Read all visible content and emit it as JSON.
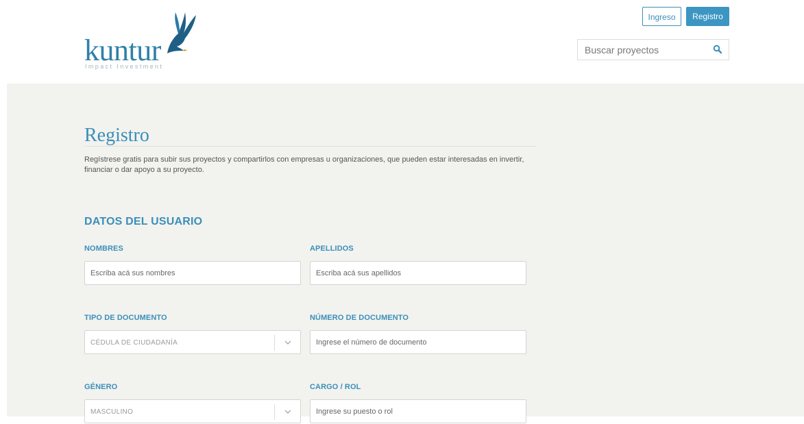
{
  "brand": {
    "name": "kuntur",
    "tagline": "Impact Investment",
    "accent": "#3b8fb9"
  },
  "header": {
    "login_label": "Ingreso",
    "register_label": "Registro",
    "search": {
      "placeholder": "Buscar proyectos",
      "icon": "search-icon"
    }
  },
  "page": {
    "title": "Registro",
    "intro": "Regístrese gratis para subir sus proyectos y compartirlos con empresas u organizaciones, que pueden estar interesadas en invertir, financiar o dar apoyo a su proyecto."
  },
  "form": {
    "section_title": "DATOS DEL USUARIO",
    "fields": {
      "nombres": {
        "label": "NOMBRES",
        "placeholder": "Escriba acá sus nombres"
      },
      "apellidos": {
        "label": "APELLIDOS",
        "placeholder": "Escriba acá sus apellidos"
      },
      "tipo_documento": {
        "label": "TIPO DE DOCUMENTO",
        "value": "CÉDULA DE CIUDADANÍA"
      },
      "numero_documento": {
        "label": "NÚMERO DE DOCUMENTO",
        "placeholder": "Ingrese el número de documento"
      },
      "genero": {
        "label": "GÉNERO",
        "value": "MASCULINO"
      },
      "cargo": {
        "label": "CARGO / ROL",
        "placeholder": "Ingrese su puesto o rol"
      }
    }
  }
}
